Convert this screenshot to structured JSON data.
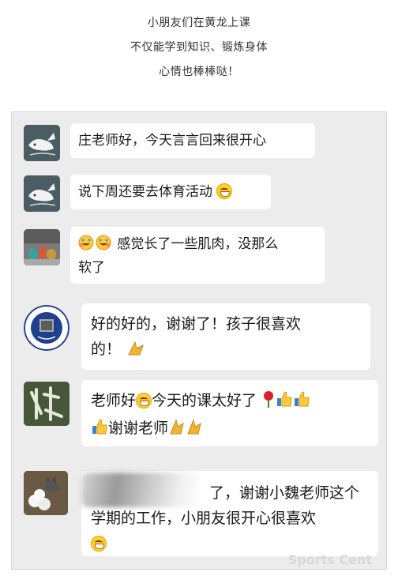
{
  "caption": {
    "lines": [
      "小朋友们在黄龙上课",
      "不仅能学到知识、锻炼身体",
      "心情也棒棒哒！"
    ]
  },
  "messages": [
    {
      "text": "庄老师好，今天言言回来很开心"
    },
    {
      "text": "说下周还要去体育活动"
    },
    {
      "text_line1": "感觉长了一些肌肉，没那么",
      "text_line2": "软了"
    },
    {
      "text_line1": "好的好的，谢谢了！孩子很喜欢",
      "text_line2": "的！"
    },
    {
      "text_line1": "老师好",
      "text_line1b": "今天的课太好了",
      "text_line2": "谢谢老师"
    },
    {
      "text_line1": "了，谢谢小魏老师这个",
      "text_line2": "学期的工作，小朋友很开心很喜欢"
    }
  ],
  "watermark": "Sports Cent",
  "icons": {
    "avatar_1": "whale-avatar-icon",
    "avatar_2": "whale-avatar-icon",
    "avatar_3": "figurines-avatar-icon",
    "avatar_4": "university-seal-avatar-icon",
    "avatar_5": "calligraphy-avatar-icon",
    "avatar_6": "cat-flowers-avatar-icon"
  },
  "colors": {
    "chat_background": "#ececec",
    "bubble": "#ffffff",
    "whale_avatar_bg": "#4b5d63",
    "seal_blue": "#1f3f8f"
  }
}
